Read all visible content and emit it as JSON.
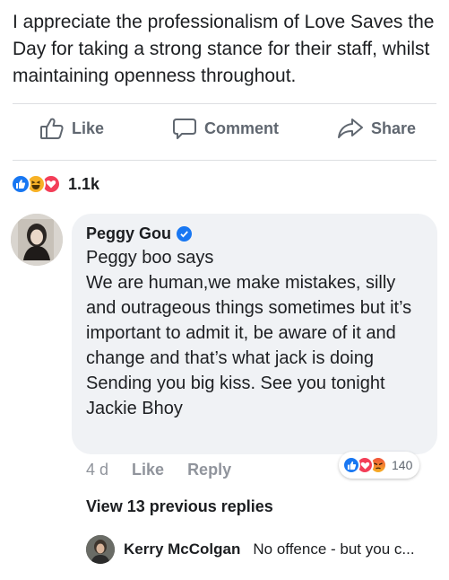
{
  "post": {
    "text": "I appreciate the professionalism of Love Saves the Day for taking a strong stance for their staff, whilst maintaining openness throughout."
  },
  "actions": {
    "like_label": "Like",
    "comment_label": "Comment",
    "share_label": "Share"
  },
  "reactions": {
    "icons": [
      "like-icon",
      "haha-icon",
      "love-icon"
    ],
    "count": "1.1k"
  },
  "comment": {
    "author": "Peggy Gou",
    "verified": true,
    "text": "Peggy boo says\nWe are human,we make mistakes, silly and outrageous things sometimes but it’s important to admit it, be aware of it and change and that’s what jack is doing\nSending you big kiss. See you tonight Jackie Bhoy",
    "time": "4 d",
    "like_label": "Like",
    "reply_label": "Reply",
    "reaction_icons": [
      "like-icon",
      "love-icon",
      "angry-icon"
    ],
    "reaction_count": "140"
  },
  "view_replies_label": "View 13 previous replies",
  "reply": {
    "author": "Kerry McColgan",
    "snippet": "No offence - but you c..."
  },
  "colors": {
    "brand_blue": "#1877f2",
    "love_red": "#f33e58",
    "haha_yellow": "#f7b125",
    "muted_text": "#90949c",
    "bubble_bg": "#f0f2f5"
  }
}
